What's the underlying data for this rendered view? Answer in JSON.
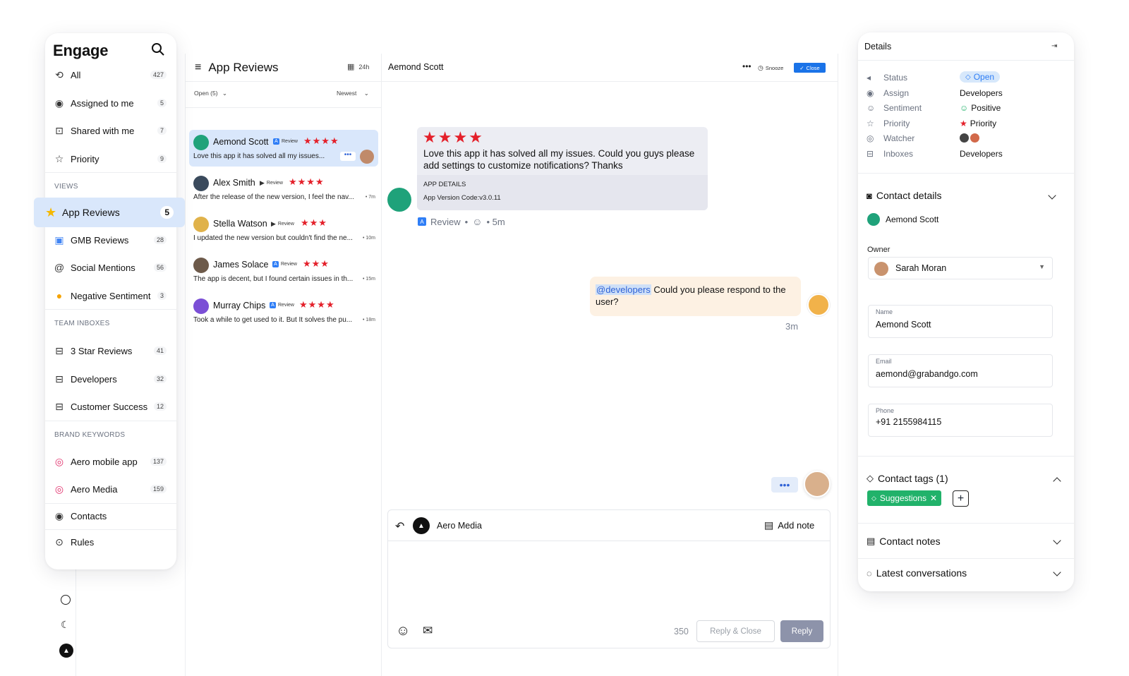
{
  "sidebar": {
    "brand": "Engage",
    "items": [
      {
        "label": "All",
        "count": "427"
      },
      {
        "label": "Assigned to me",
        "count": "5"
      },
      {
        "label": "Shared with me",
        "count": "7"
      },
      {
        "label": "Priority",
        "count": "9"
      }
    ],
    "views_label": "VIEWS",
    "views": [
      {
        "label": "App Reviews",
        "count": "5"
      },
      {
        "label": "GMB Reviews",
        "count": "28"
      },
      {
        "label": "Social Mentions",
        "count": "56"
      },
      {
        "label": "Negative Sentiment",
        "count": "3"
      }
    ],
    "team_label": "TEAM INBOXES",
    "team": [
      {
        "label": "3 Star Reviews",
        "count": "41"
      },
      {
        "label": "Developers",
        "count": "32"
      },
      {
        "label": "Customer Success",
        "count": "12"
      }
    ],
    "brand_label": "BRAND KEYWORDS",
    "brand_kw": [
      {
        "label": "Aero mobile app",
        "count": "137"
      },
      {
        "label": "Aero Media",
        "count": "159"
      }
    ],
    "contacts": "Contacts",
    "rules": "Rules"
  },
  "list": {
    "title": "App Reviews",
    "range": "24h",
    "filter": "Open (5)",
    "sort": "Newest",
    "conversations": [
      {
        "name": "Aemond Scott",
        "source": "Review",
        "stars": "★★★★",
        "snippet": "Love this app it has solved all my issues...",
        "time": ""
      },
      {
        "name": "Alex Smith",
        "source": "Review",
        "stars": "★★★★",
        "snippet": "After the release of the new version, I feel the nav...",
        "time": "• 7m"
      },
      {
        "name": "Stella Watson",
        "source": "Review",
        "stars": "★★★",
        "snippet": "I updated the new version but couldn't find the ne...",
        "time": "• 10m"
      },
      {
        "name": "James Solace",
        "source": "Review",
        "stars": "★★★",
        "snippet": "The app is decent, but I found certain issues in th...",
        "time": "• 15m"
      },
      {
        "name": "Murray Chips",
        "source": "Review",
        "stars": "★★★★",
        "snippet": "Took a while to get used to it. But It solves the pu...",
        "time": "• 18m"
      }
    ]
  },
  "chat": {
    "contact_name": "Aemond Scott",
    "snooze": "Snooze",
    "close": "Close",
    "review_stars": "★★★★",
    "review_text": "Love this app it has solved all my issues. Could you guys please add settings to customize notifications? Thanks",
    "app_details_label": "APP DETAILS",
    "app_version": "App Version Code:v3.0.11",
    "review_meta": "Review",
    "review_time": "• 5m",
    "note_mention": "@developers",
    "note_text": " Could you please respond to the user?",
    "note_time": "3m",
    "composer_account": "Aero Media",
    "add_note": "Add note",
    "char_count": "350",
    "reply_close": "Reply & Close",
    "reply": "Reply"
  },
  "details": {
    "title": "Details",
    "rows": [
      {
        "label": "Status",
        "value": "Open"
      },
      {
        "label": "Assign",
        "value": "Developers"
      },
      {
        "label": "Sentiment",
        "value": "Positive"
      },
      {
        "label": "Priority",
        "value": "Priority"
      },
      {
        "label": "Watcher",
        "value": ""
      },
      {
        "label": "Inboxes",
        "value": "Developers"
      }
    ],
    "contact_details": "Contact details",
    "contact_name": "Aemond Scott",
    "owner_label": "Owner",
    "owner": "Sarah Moran",
    "name_label": "Name",
    "name": "Aemond Scott",
    "email_label": "Email",
    "email": "aemond@grabandgo.com",
    "phone_label": "Phone",
    "phone": "+91 2155984115",
    "tags_header": "Contact tags (1)",
    "tag": "Suggestions",
    "notes_header": "Contact notes",
    "latest_header": "Latest conversations"
  },
  "colors": {
    "accent": "#1a73e8",
    "selected": "#d9e7fb",
    "star": "#e4202a",
    "review_bubble": "#ecedf3",
    "note_bubble": "#fdf1e3",
    "tag_green": "#21b26a",
    "reply_button": "#8d93aa"
  }
}
